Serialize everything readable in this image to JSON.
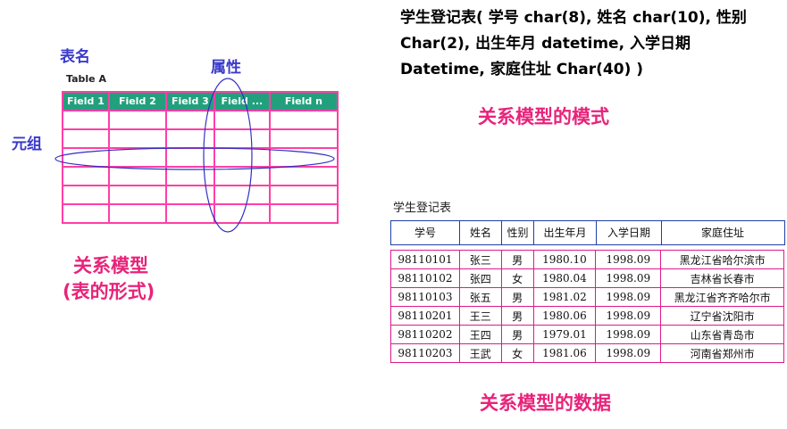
{
  "labels": {
    "table_name": "表名",
    "attribute": "属性",
    "tuple": "元组",
    "table_caption": "Table A",
    "rel_model_form_line1": "关系模型",
    "rel_model_form_line2": "(表的形式)",
    "schema_title": "关系模型的模式",
    "data_title": "关系模型的数据"
  },
  "schema_table": {
    "headers": [
      "Field 1",
      "Field 2",
      "Field 3",
      "Field ...",
      "Field n"
    ],
    "empty_rows": 6
  },
  "schema_text": "学生登记表( 学号  char(8), 姓名 char(10), 性别  Char(2), 出生年月 datetime, 入学日期  Datetime, 家庭住址 Char(40) )",
  "data_table": {
    "caption": "学生登记表",
    "columns": [
      "学号",
      "姓名",
      "性别",
      "出生年月",
      "入学日期",
      "家庭住址"
    ],
    "rows": [
      [
        "98110101",
        "张三",
        "男",
        "1980.10",
        "1998.09",
        "黑龙江省哈尔滨市"
      ],
      [
        "98110102",
        "张四",
        "女",
        "1980.04",
        "1998.09",
        "吉林省长春市"
      ],
      [
        "98110103",
        "张五",
        "男",
        "1981.02",
        "1998.09",
        "黑龙江省齐齐哈尔市"
      ],
      [
        "98110201",
        "王三",
        "男",
        "1980.06",
        "1998.09",
        "辽宁省沈阳市"
      ],
      [
        "98110202",
        "王四",
        "男",
        "1979.01",
        "1998.09",
        "山东省青岛市"
      ],
      [
        "98110203",
        "王武",
        "女",
        "1981.06",
        "1998.09",
        "河南省郑州市"
      ]
    ]
  },
  "colors": {
    "label_blue": "#3a3acb",
    "title_pink": "#e8237a",
    "header_green": "#22a07d",
    "grid_pink": "#ff3fa6",
    "ellipse_blue": "#3030c0"
  }
}
